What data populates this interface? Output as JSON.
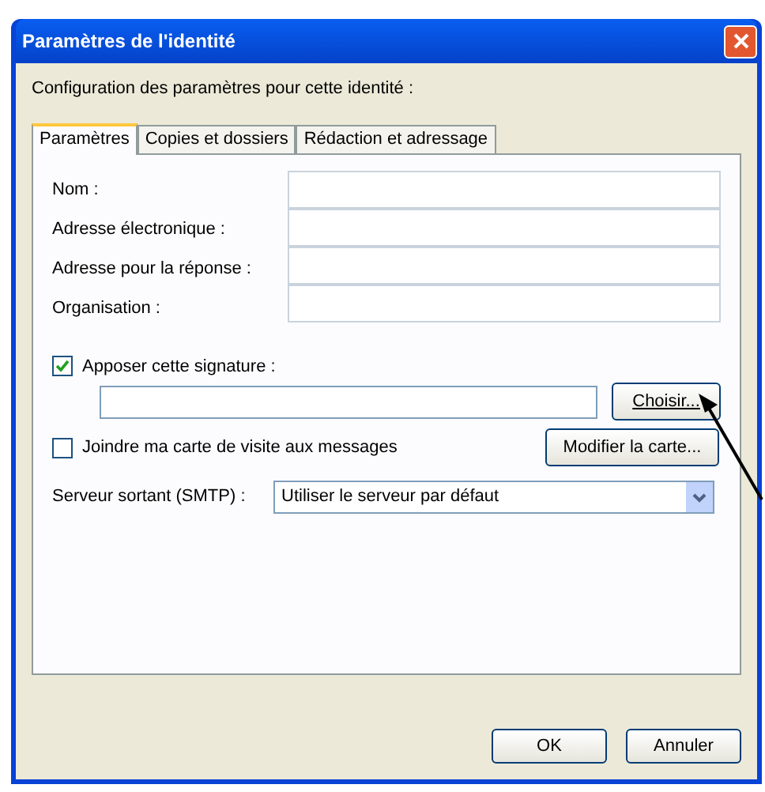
{
  "window": {
    "title": "Paramètres de l'identité"
  },
  "intro": "Configuration des paramètres pour cette identité :",
  "tabs": [
    {
      "label": "Paramètres",
      "selected": true
    },
    {
      "label": "Copies et dossiers",
      "selected": false
    },
    {
      "label": "Rédaction et adressage",
      "selected": false
    }
  ],
  "fields": [
    {
      "label": "Nom :"
    },
    {
      "label": "Adresse électronique :"
    },
    {
      "label": "Adresse pour la réponse :"
    },
    {
      "label": "Organisation :"
    }
  ],
  "signature": {
    "label": "Apposer cette signature :",
    "checked": true,
    "button": "Choisir..."
  },
  "vcard": {
    "label": "Joindre ma carte de visite aux messages",
    "checked": false,
    "button": "Modifier la carte..."
  },
  "smtp": {
    "label": "Serveur sortant (SMTP) :",
    "value": "Utiliser le serveur par défaut"
  },
  "buttons": [
    "OK",
    "Annuler"
  ]
}
